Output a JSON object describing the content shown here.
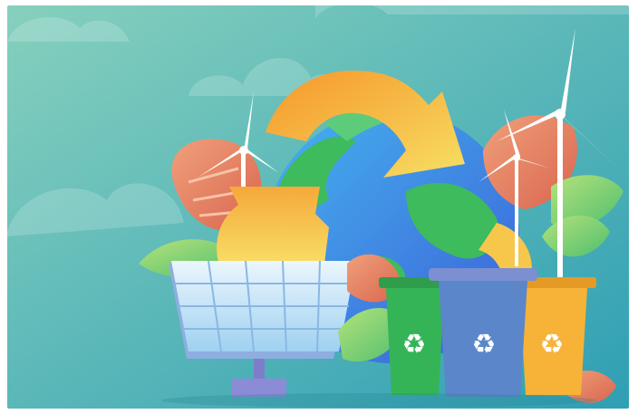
{
  "illustration": {
    "subject": "",
    "palette": {
      "sky_top": "#74c6b8",
      "sky_bottom": "#3aa8b3",
      "ocean": "#3f8fe0",
      "land": "#3dbb5d",
      "arrow_orange": "#f59a2a",
      "arrow_yellow": "#f6d35a",
      "panel": "#cfe6f7",
      "bin_green": "#35b457",
      "bin_blue": "#5b86c9",
      "bin_yellow": "#f6b338",
      "leaf_orange": "#e98a6c",
      "leaf_green": "#8cd25a"
    },
    "icons": {
      "recycle": "recycle-icon",
      "wind_turbine": "wind-turbine-icon",
      "solar_panel": "solar-panel-icon",
      "globe": "globe-icon"
    }
  }
}
